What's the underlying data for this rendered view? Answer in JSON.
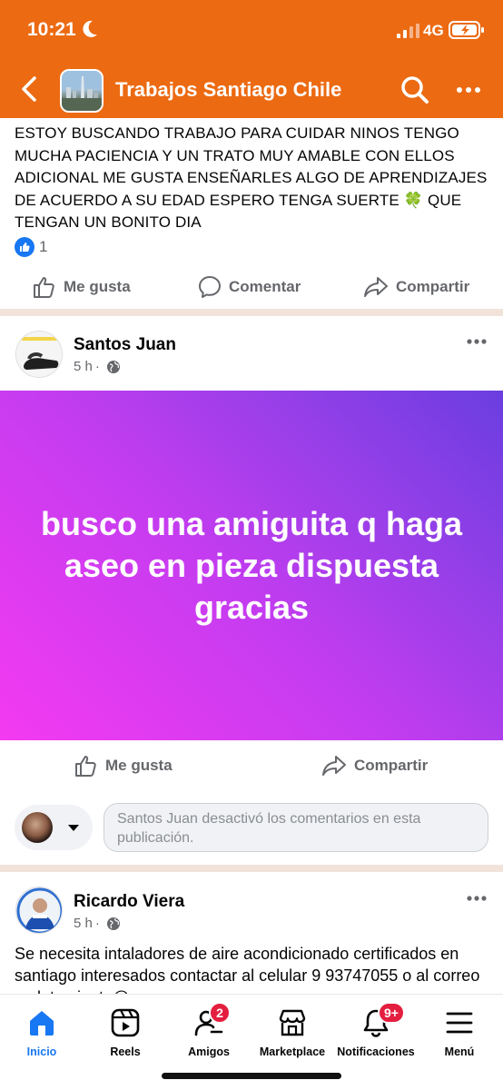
{
  "status_bar": {
    "time": "10:21",
    "network": "4G"
  },
  "header": {
    "title": "Trabajos Santiago Chile"
  },
  "post1": {
    "text": "ESTOY BUSCANDO TRABAJO PARA CUIDAR NINOS TENGO MUCHA PACIENCIA Y UN TRATO MUY AMABLE CON ELLOS ADICIONAL ME GUSTA ENSEÑARLES ALGO DE APRENDIZAJES  DE ACUERDO A SU EDAD ESPERO TENGA SUERTE 🍀 QUE TENGAN UN BONITO DIA",
    "reaction_count": "1",
    "actions": {
      "like": "Me gusta",
      "comment": "Comentar",
      "share": "Compartir"
    }
  },
  "post2": {
    "author": "Santos Juan",
    "time": "5 h",
    "text": "busco una amiguita q haga aseo en pieza dispuesta gracias",
    "actions": {
      "like": "Me gusta",
      "share": "Compartir"
    },
    "comments_disabled": "Santos Juan desactivó los comentarios en esta publicación."
  },
  "post3": {
    "author": "Ricardo Viera",
    "time": "5 h",
    "text": "Se necesita intaladores de aire acondicionado certificados en santiago interesados contactar al celular 9 93747055 o al correo reclutamiento@rsrgrup.com"
  },
  "tabs": [
    {
      "label": "Inicio",
      "icon": "home-icon",
      "active": true
    },
    {
      "label": "Reels",
      "icon": "reels-icon"
    },
    {
      "label": "Amigos",
      "icon": "friends-icon",
      "badge": "2"
    },
    {
      "label": "Marketplace",
      "icon": "marketplace-icon"
    },
    {
      "label": "Notificaciones",
      "icon": "bell-icon",
      "badge": "9+"
    },
    {
      "label": "Menú",
      "icon": "menu-icon"
    }
  ],
  "colors": {
    "header": "#ec6a12",
    "accent": "#1877f2",
    "badge": "#e41e3f"
  }
}
